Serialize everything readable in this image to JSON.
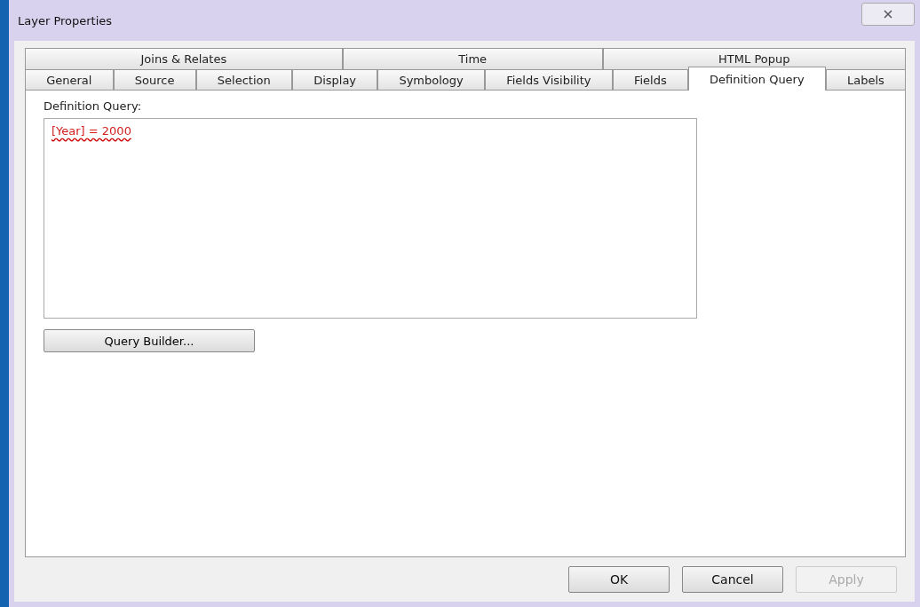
{
  "window": {
    "title": "Layer Properties"
  },
  "tab_rows": [
    [
      {
        "label": "Joins & Relates",
        "selected": false
      },
      {
        "label": "Time",
        "selected": false
      },
      {
        "label": "HTML Popup",
        "selected": false
      }
    ],
    [
      {
        "label": "General",
        "selected": false
      },
      {
        "label": "Source",
        "selected": false
      },
      {
        "label": "Selection",
        "selected": false
      },
      {
        "label": "Display",
        "selected": false
      },
      {
        "label": "Symbology",
        "selected": false
      },
      {
        "label": "Fields Visibility",
        "selected": false
      },
      {
        "label": "Fields",
        "selected": false
      },
      {
        "label": "Definition Query",
        "selected": true
      },
      {
        "label": "Labels",
        "selected": false
      }
    ]
  ],
  "definition_query": {
    "label": "Definition Query:",
    "value": "[Year] = 2000",
    "error_marked": true
  },
  "query_builder_button": "Query Builder...",
  "buttons": [
    {
      "label": "OK",
      "disabled": false
    },
    {
      "label": "Cancel",
      "disabled": false
    },
    {
      "label": "Apply",
      "disabled": true
    }
  ]
}
